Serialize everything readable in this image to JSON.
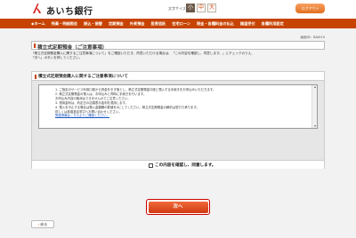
{
  "header": {
    "logo_text": "あいち銀行",
    "font_size_label": "文字サイズ変更",
    "font_sizes": [
      "小",
      "中",
      "大"
    ],
    "logout_label": "ログアウト"
  },
  "nav": {
    "items": [
      "ホーム",
      "残高・明細照会",
      "振込・振替",
      "定期預金",
      "外貨預金",
      "投資信託",
      "住宅ローン",
      "税金・各種料金の払込",
      "諸届受付",
      "各種利用設定"
    ]
  },
  "screen_id": "画面ID：BAI010",
  "page_title": "積立式定期預金（ご注意事項）",
  "intro": [
    "「積立式定期預金購入に関するご注意事項について」をご確認いただき、同意いただける場合は、「この内容を確認し、同意します。」にチェックのうえ、",
    "「次へ」ボタンを押してください。"
  ],
  "panel": {
    "title": "積立式定期預金購入に関するご注意事項について",
    "terms": [
      "1.  ご指定のサービス利用口座から資金を引き落とし、積立式定期預金口座に預入する手続きをお申込みいただきます。",
      "2.  積立式定期預金の預入は、お申込みと同時に手続きを行います。",
      "     お申込み内容の取消はできませんのでご注意ください。",
      "3.  適用金利は、約定日の店頭表示金利を適用します。",
      "4.  預入を中止する場合は預入金額欄の数値を0にしてください。積立式定期預金の解約は窓口で承ります。",
      "     詳しくは各取扱店窓口へお問い合わせください。"
    ],
    "link": "関連情報はこちらよりご確認ください。",
    "check_label": "この内容を確認し、同意します。"
  },
  "next_label": "次へ",
  "back_label": "戻る",
  "colors": {
    "brand": "#c74400",
    "button": "#e05020"
  }
}
